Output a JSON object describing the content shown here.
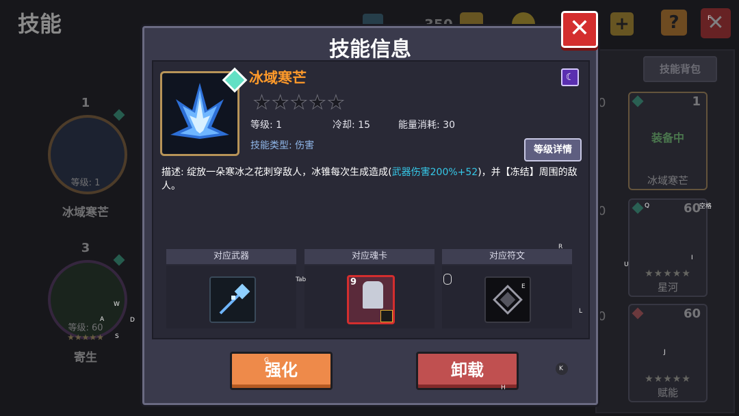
{
  "page_title": "技能",
  "top_bar": {
    "counter_value": "350",
    "icons": [
      "gem-icon",
      "plus-icon",
      "coin-icon",
      "plus-icon",
      "help-icon",
      "close-icon"
    ],
    "help_label": "?",
    "close_label": "✕"
  },
  "left_slots": [
    {
      "number": "1",
      "level": "等级: 1",
      "name": "冰域寒芒"
    },
    {
      "number": "3",
      "level": "等级: 60",
      "stars": "★★★★★",
      "name": "寄生"
    }
  ],
  "right_panel": {
    "tab": "技能背包",
    "cards": [
      {
        "level": "1",
        "overlay": "装备中",
        "name": "冰域寒芒"
      },
      {
        "level": "60",
        "stars": "★★★★★",
        "name": "星河"
      },
      {
        "level": "60",
        "stars": "★★★★★",
        "name": "赋能"
      }
    ],
    "partial_levels": [
      "0",
      "0",
      "0"
    ]
  },
  "dialog": {
    "title": "技能信息",
    "close_label": "✕",
    "skill": {
      "name": "冰域寒芒",
      "stars_filled": 0,
      "stars_total": 5,
      "star_glyphs": "★★★★★",
      "level": "等级: 1",
      "cooldown": "冷却: 15",
      "energy": "能量消耗: 30",
      "type": "技能类型: 伤害",
      "type_badge": "☾",
      "detail_button": "等级详情",
      "desc_prefix": "描述: 绽放一朵寒冰之花刺穿敌人，冰锥每次生成造成(",
      "desc_highlight": "武器伤害200%+52",
      "desc_suffix": ")，并【冻结】周围的敌人。"
    },
    "slots": [
      {
        "label": "对应武器",
        "icon": "ice-staff-icon"
      },
      {
        "label": "对应魂卡",
        "icon": "soul-card-icon",
        "card_level": "9"
      },
      {
        "label": "对应符文",
        "icon": "rune-icon"
      }
    ],
    "strengthen_button": "强化",
    "unload_button": "卸载"
  },
  "key_hints": {
    "w": "W",
    "a": "A",
    "s": "S",
    "d": "D",
    "tab": "Tab",
    "e": "E",
    "r": "R",
    "q": "Q",
    "space": "空格",
    "u": "U",
    "i": "I",
    "l": "L",
    "j": "J",
    "k": "K",
    "h": "H",
    "g": "G",
    "f": "F"
  },
  "colors": {
    "skill_name": "#ff9a2a",
    "highlight": "#35c8e8",
    "close_red": "#d42e2e",
    "strengthen": "#ee8a4a",
    "unload": "#c05050",
    "frame_gold": "#b89458"
  }
}
